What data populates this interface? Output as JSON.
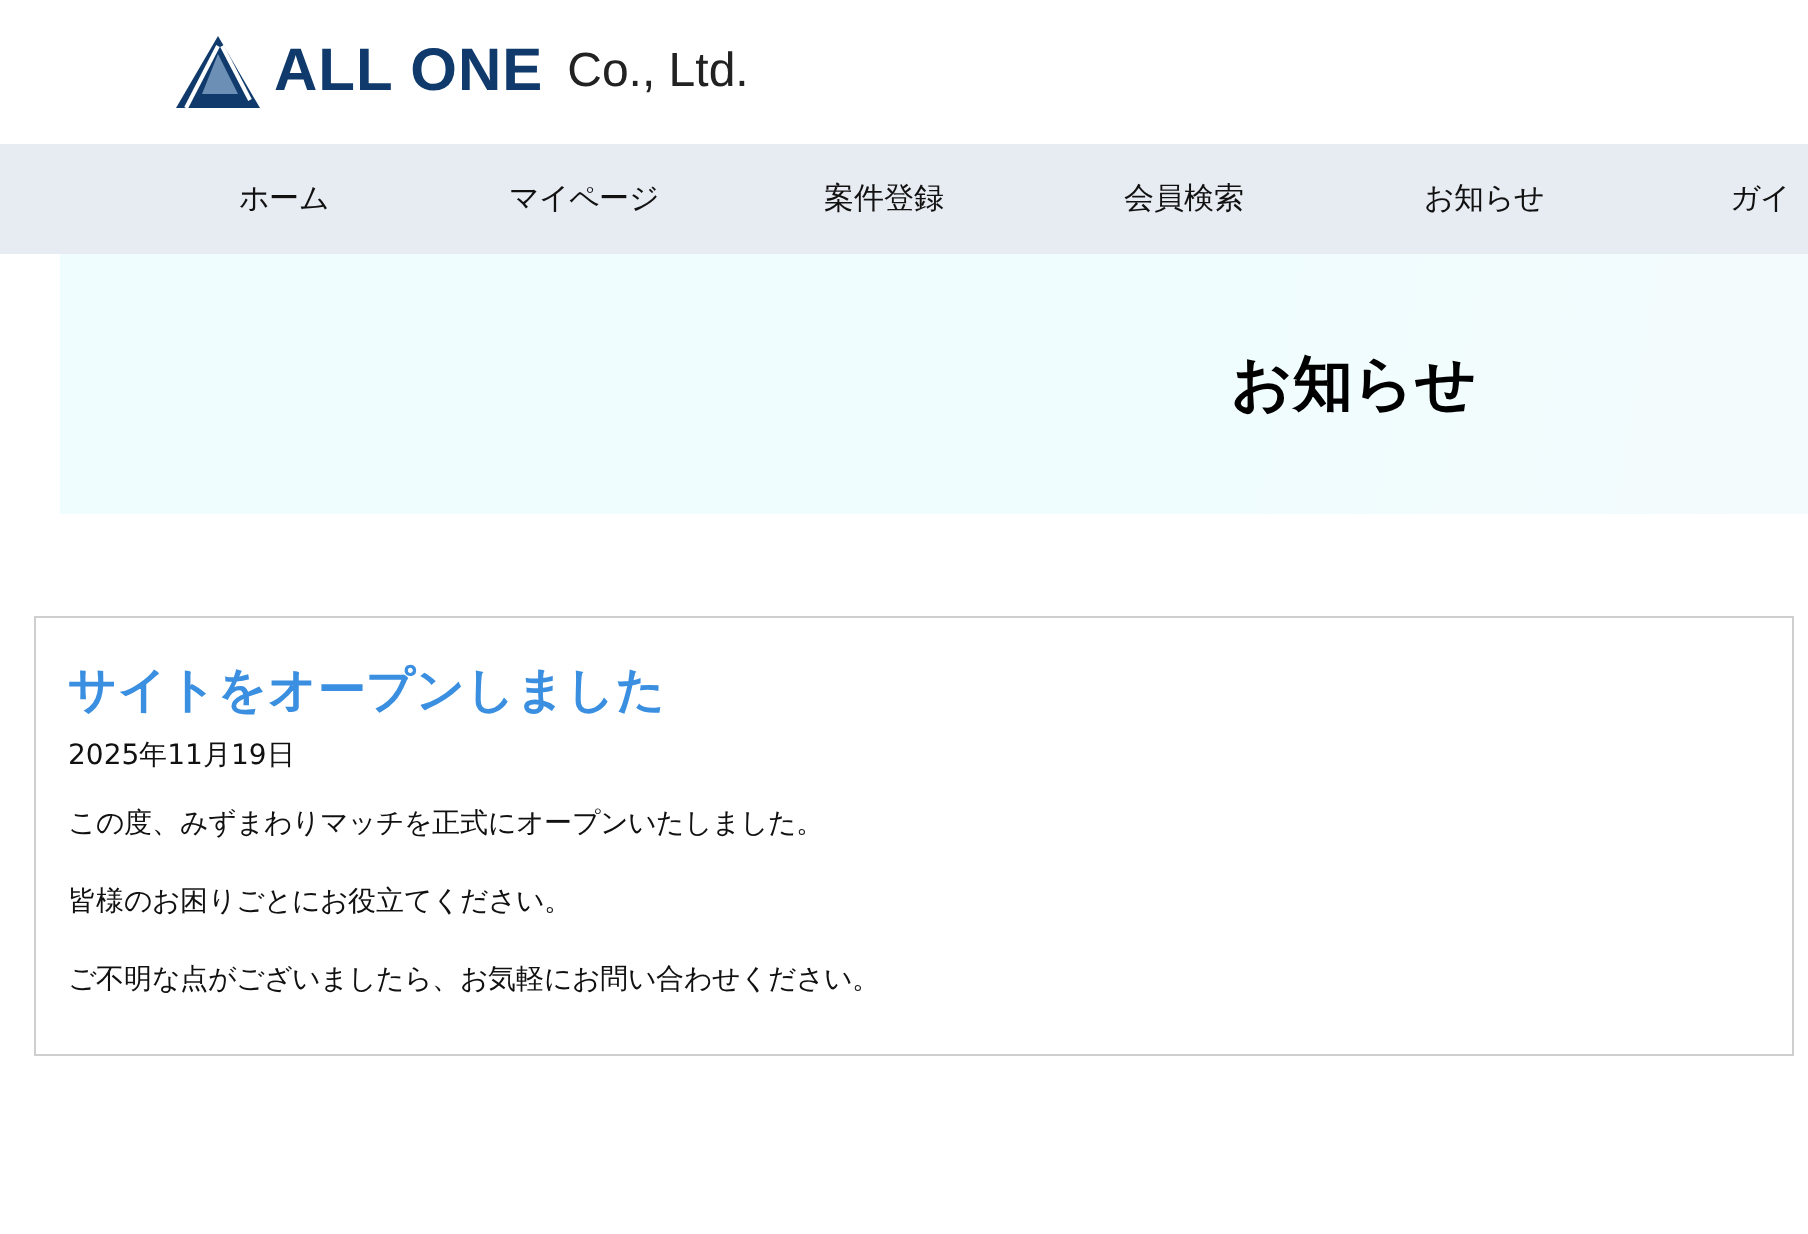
{
  "logo": {
    "brand": "ALL ONE",
    "suffix": "Co., Ltd."
  },
  "nav": [
    {
      "label": "ホーム"
    },
    {
      "label": "マイページ"
    },
    {
      "label": "案件登録"
    },
    {
      "label": "会員検索"
    },
    {
      "label": "お知らせ"
    },
    {
      "label": "ガイ"
    }
  ],
  "banner": {
    "title": "お知らせ"
  },
  "post": {
    "title": "サイトをオープンしました",
    "date": "2025年11月19日",
    "paragraphs": [
      "この度、みずまわりマッチを正式にオープンいたしました。",
      "皆様のお困りごとにお役立てください。",
      "ご不明な点がございましたら、お気軽にお問い合わせください。"
    ]
  }
}
